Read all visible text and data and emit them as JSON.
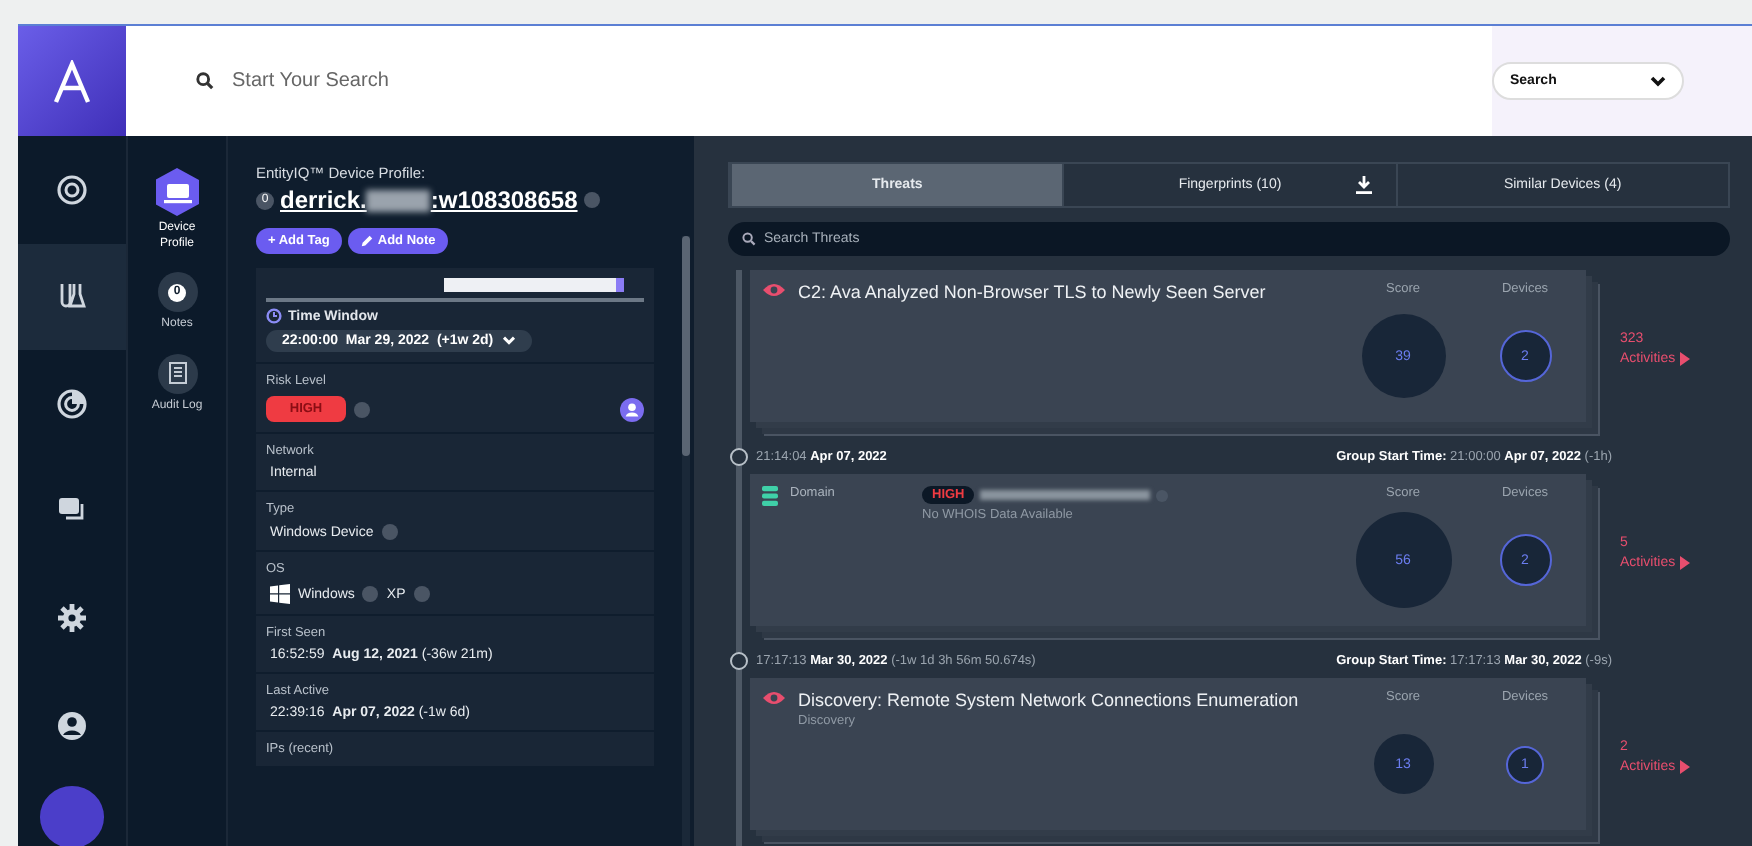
{
  "header": {
    "search_placeholder": "Start Your Search",
    "search_mode": "Search"
  },
  "nav": [
    {
      "selected": false
    },
    {
      "selected": true
    },
    {
      "selected": false
    },
    {
      "selected": false
    },
    {
      "selected": false
    },
    {
      "selected": false
    }
  ],
  "subnav": [
    {
      "label": "Device Profile",
      "selected": true
    },
    {
      "label": "Notes",
      "badge": "0",
      "selected": false
    },
    {
      "label": "Audit Log",
      "selected": false
    }
  ],
  "profile": {
    "caption": "EntityIQ™ Device Profile:",
    "badge": "0",
    "name_start": "derrick.",
    "name_end": ":w108308658",
    "buttons": [
      {
        "kind": "tag",
        "label": "+ Add Tag"
      },
      {
        "kind": "note",
        "label": "Add Note"
      }
    ],
    "time_window": {
      "label": "Time Window",
      "value": "22:00:00  Mar 29, 2022  (+1w 2d)"
    },
    "risk": {
      "label": "Risk Level",
      "value": "HIGH"
    },
    "fields": [
      {
        "kind": "text",
        "label": "Network",
        "value": "Internal"
      },
      {
        "kind": "select",
        "label": "Type",
        "value": "Windows Device"
      },
      {
        "kind": "os",
        "label": "OS",
        "value": "Windows",
        "version": "XP"
      },
      {
        "kind": "rich",
        "label": "First Seen",
        "value": "16:52:59  **Aug 12, 2021** (-36w 21m)"
      },
      {
        "kind": "rich",
        "label": "Last Active",
        "value": "22:39:16  **Apr 07, 2022** (-1w 6d)"
      },
      {
        "label": "IPs (recent)"
      }
    ]
  },
  "tabs": [
    {
      "label": "Threats",
      "selected": true
    },
    {
      "label": "Fingerprints (10)",
      "selected": false,
      "download": true
    },
    {
      "label": "Similar Devices (4)",
      "selected": false
    }
  ],
  "threat_search": {
    "placeholder": "Search Threats"
  },
  "timeline": [
    {
      "kind": "threat",
      "title": "C2: Ava Analyzed Non-Browser TLS to Newly Seen Server",
      "score_label": "Score",
      "score": "39",
      "devices_label": "Devices",
      "devices": "2",
      "count": "323",
      "activities": "Activities"
    },
    {
      "kind": "domain",
      "time": "21:14:04 **Apr 07, 2022**",
      "group": "**Group Start Time:** 21:00:00 **Apr 07, 2022** (-1h)",
      "title": "Domain",
      "risk": "HIGH",
      "subtitle": "No WHOIS Data Available",
      "score_label": "Score",
      "score": "56",
      "devices_label": "Devices",
      "devices": "2",
      "count": "5",
      "activities": "Activities"
    },
    {
      "kind": "threat",
      "time": "17:17:13 **Mar 30, 2022** (-1w 1d 3h 56m 50.674s)",
      "group": "**Group Start Time:** 17:17:13 **Mar 30, 2022** (-9s)",
      "title": "Discovery: Remote System Network Connections Enumeration",
      "subtitle": "Discovery",
      "score_label": "Score",
      "score": "13",
      "devices_label": "Devices",
      "devices": "1",
      "count": "2",
      "activities": "Activities"
    }
  ]
}
